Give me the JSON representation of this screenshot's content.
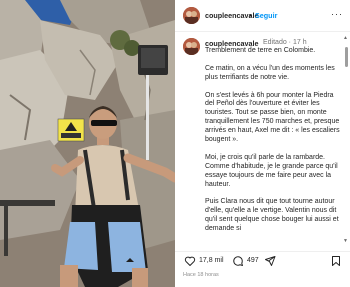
{
  "post": {
    "username": "coupleencavale",
    "follow_label": "Seguir",
    "more_label": "···",
    "separator": "•"
  },
  "caption": {
    "username": "coupleencavale",
    "meta": "Editado · 17 h",
    "lines": [
      "Tremblement de terre en Colombie.",
      "",
      "Ce matin, on a vécu l'un des moments les plus terrifiants de notre vie.",
      "",
      "On s'est levés à 6h pour monter la Piedra del Peñol dès l'ouverture et éviter les touristes. Tout se passe bien, on monte tranquillement les 750 marches et, presque arrivés en haut, Axel me dit : « les escaliers bougent ».",
      "",
      "Moi, je crois qu'il parle de la rambarde. Comme d'habitude, je le grande parce qu'il essaye toujours de me faire peur avec la hauteur.",
      "",
      "Puis Clara nous dit que tout tourne autour d'elle, qu'elle a le vertige. Valentin nous dit qu'il sent quelque chose bouger lui aussi et demande si"
    ]
  },
  "actions": {
    "likes": "17,8 mil",
    "comments": "497",
    "time_ago": "Hace 18 horas"
  },
  "icons": {
    "like": "heart-icon",
    "comment": "comment-icon",
    "share": "share-icon",
    "save": "bookmark-icon"
  },
  "photo": {
    "sign_text": "⚠"
  }
}
